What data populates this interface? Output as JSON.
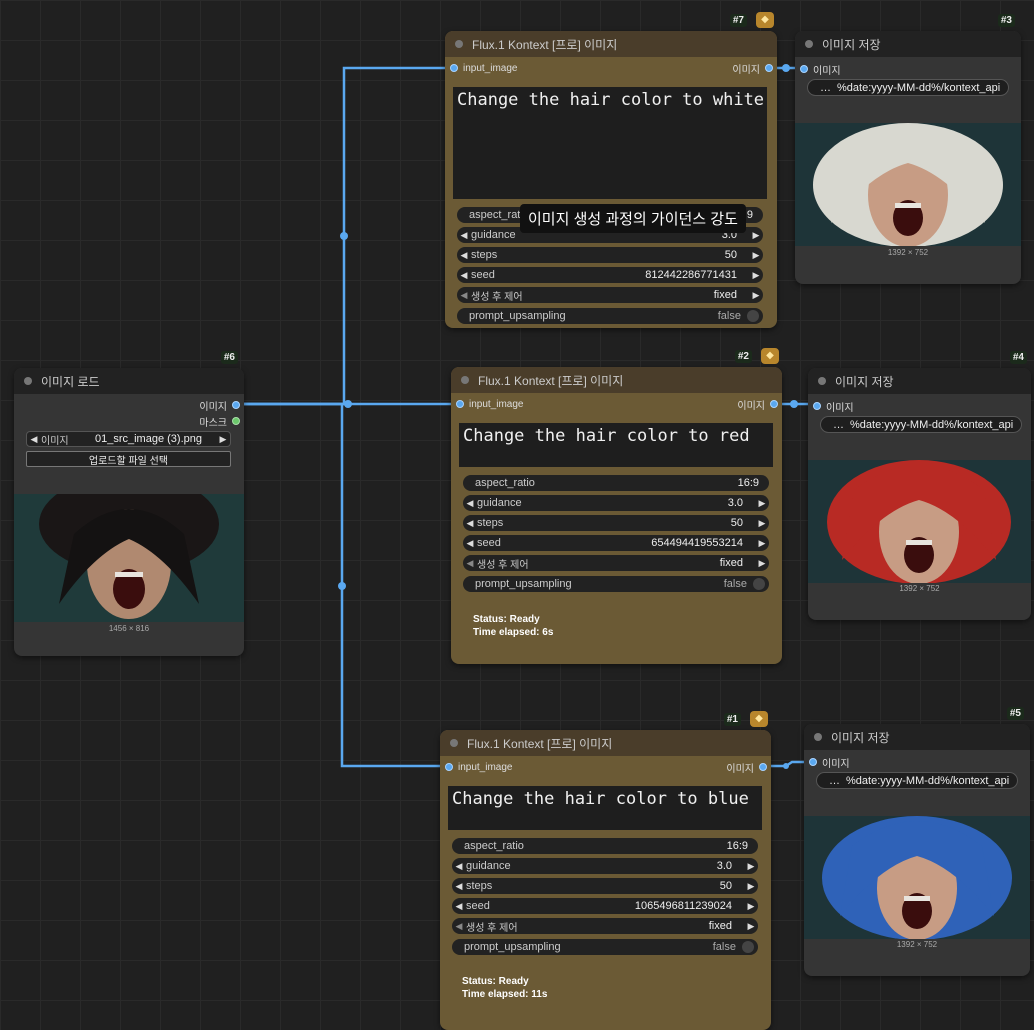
{
  "colors": {
    "wire": "#5aa8f0",
    "gold_node": "#6b5a35",
    "gray_node": "#353535",
    "canvas": "#202020"
  },
  "tooltip": "이미지 생성 과정의 가이던스 강도",
  "load_node": {
    "id": "#6",
    "title": "이미지 로드",
    "out_image": "이미지",
    "out_mask": "마스크",
    "image_label": "이미지",
    "image_value": "01_src_image (3).png",
    "upload_button": "업로드할 파일 선택",
    "size": "1456 × 816"
  },
  "flux_nodes": [
    {
      "id": "#7",
      "title": "Flux.1 Kontext [프로] 이미지",
      "input": "input_image",
      "output": "이미지",
      "prompt": "Change the hair color to white",
      "aspect_label": "aspect_ratio",
      "aspect": "16:9",
      "guidance_label": "guidance",
      "guidance": "3.0",
      "steps_label": "steps",
      "steps": "50",
      "seed_label": "seed",
      "seed": "812442286771431",
      "control_label": "생성 후 제어",
      "control": "fixed",
      "upsampling_label": "prompt_upsampling",
      "upsampling": "false",
      "status": "",
      "time": ""
    },
    {
      "id": "#2",
      "title": "Flux.1 Kontext [프로] 이미지",
      "input": "input_image",
      "output": "이미지",
      "prompt": "Change the hair color to red",
      "aspect_label": "aspect_ratio",
      "aspect": "16:9",
      "guidance_label": "guidance",
      "guidance": "3.0",
      "steps_label": "steps",
      "steps": "50",
      "seed_label": "seed",
      "seed": "654494419553214",
      "control_label": "생성 후 제어",
      "control": "fixed",
      "upsampling_label": "prompt_upsampling",
      "upsampling": "false",
      "status": "Status: Ready",
      "time": "Time elapsed: 6s"
    },
    {
      "id": "#1",
      "title": "Flux.1 Kontext [프로] 이미지",
      "input": "input_image",
      "output": "이미지",
      "prompt": "Change the hair color to blue",
      "aspect_label": "aspect_ratio",
      "aspect": "16:9",
      "guidance_label": "guidance",
      "guidance": "3.0",
      "steps_label": "steps",
      "steps": "50",
      "seed_label": "seed",
      "seed": "1065496811239024",
      "control_label": "생성 후 제어",
      "control": "fixed",
      "upsampling_label": "prompt_upsampling",
      "upsampling": "false",
      "status": "Status: Ready",
      "time": "Time elapsed: 11s"
    }
  ],
  "save_nodes": [
    {
      "id": "#3",
      "title": "이미지 저장",
      "input": "이미지",
      "path": "%date:yyyy-MM-dd%/kontext_api",
      "ellipsis": "…",
      "size": "1392 × 752",
      "hair": "#d8d8d0"
    },
    {
      "id": "#4",
      "title": "이미지 저장",
      "input": "이미지",
      "path": "%date:yyyy-MM-dd%/kontext_api",
      "ellipsis": "…",
      "size": "1392 × 752",
      "hair": "#b82a24"
    },
    {
      "id": "#5",
      "title": "이미지 저장",
      "input": "이미지",
      "path": "%date:yyyy-MM-dd%/kontext_api",
      "ellipsis": "…",
      "size": "1392 × 752",
      "hair": "#2f62b8"
    }
  ]
}
